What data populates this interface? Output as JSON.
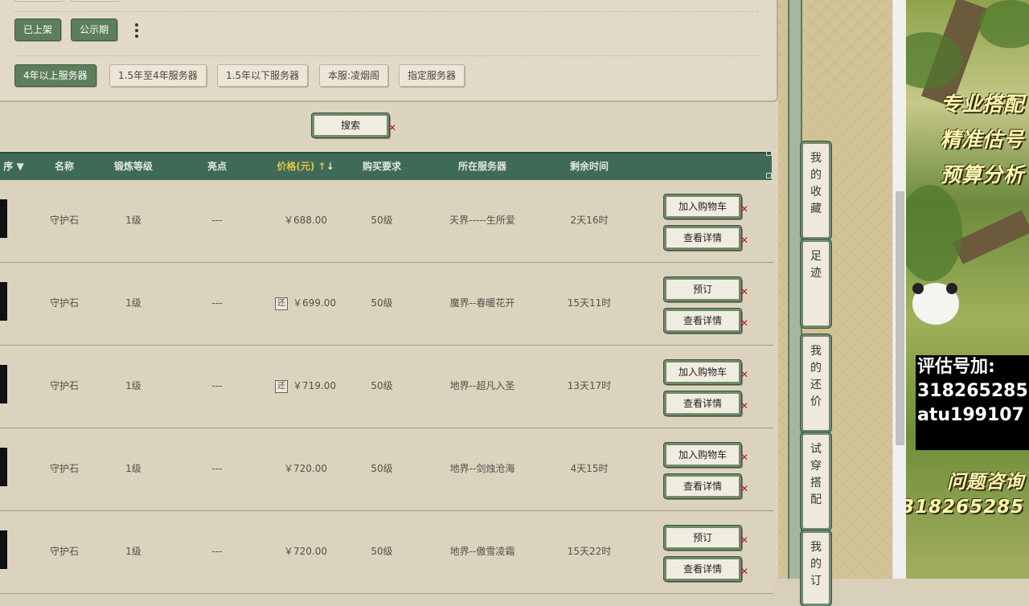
{
  "filters": {
    "status_buttons": [
      "已上架",
      "公示期"
    ],
    "server_buttons": [
      "4年以上服务器",
      "1.5年至4年服务器",
      "1.5年以下服务器",
      "本服:凌烟阁",
      "指定服务器"
    ],
    "search_label": "搜索"
  },
  "table": {
    "headers": [
      "序",
      "名称",
      "锻炼等级",
      "亮点",
      "价格(元)",
      "购买要求",
      "所在服务器",
      "剩余时间"
    ],
    "rows": [
      {
        "name": "守护石",
        "level": "1级",
        "highlight": "---",
        "price": "￥688.00",
        "requirement": "50级",
        "server": "天界-----生所爱",
        "time": "2天16时",
        "refund": "",
        "action": "加入购物车",
        "detail": "查看详情"
      },
      {
        "name": "守护石",
        "level": "1级",
        "highlight": "---",
        "price": "￥699.00",
        "requirement": "50级",
        "server": "魔界--春暖花开",
        "time": "15天11时",
        "refund": "还",
        "action": "预订",
        "detail": "查看详情"
      },
      {
        "name": "守护石",
        "level": "1级",
        "highlight": "---",
        "price": "￥719.00",
        "requirement": "50级",
        "server": "地界--超凡入圣",
        "time": "13天17时",
        "refund": "还",
        "action": "加入购物车",
        "detail": "查看详情"
      },
      {
        "name": "守护石",
        "level": "1级",
        "highlight": "---",
        "price": "￥720.00",
        "requirement": "50级",
        "server": "地界--剑烛沧海",
        "time": "4天15时",
        "refund": "",
        "action": "加入购物车",
        "detail": "查看详情"
      },
      {
        "name": "守护石",
        "level": "1级",
        "highlight": "---",
        "price": "￥720.00",
        "requirement": "50级",
        "server": "地界--傲雪凌霜",
        "time": "15天22时",
        "refund": "",
        "action": "预订",
        "detail": "查看详情"
      }
    ]
  },
  "side_tabs": [
    "我的收藏",
    "足迹",
    "我的还价",
    "试穿搭配",
    "我的订"
  ],
  "ad": {
    "slogans": [
      "专业搭配",
      "精准估号",
      "预算分析"
    ],
    "contact_lines": [
      "评估号加:",
      "318265285",
      "atu199107"
    ],
    "bottom_lines": [
      "问题咨询",
      "318265285"
    ]
  },
  "colors": {
    "header_bg": "#3f6a58",
    "dark_button": "#5d7e5a",
    "accent_sort": "#e8c24a",
    "close_x": "#b0202a"
  }
}
